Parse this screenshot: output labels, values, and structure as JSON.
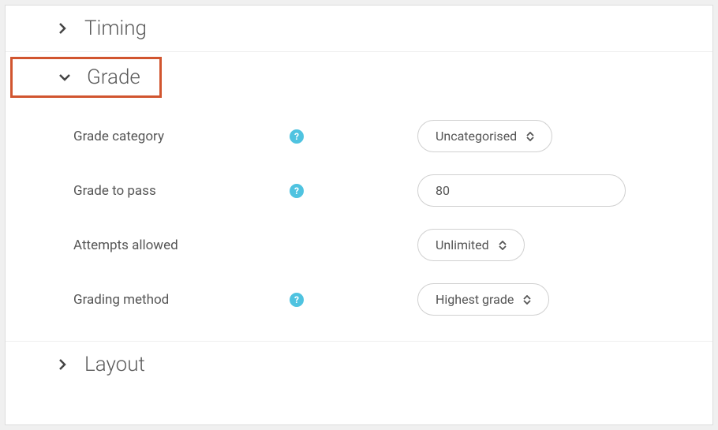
{
  "sections": {
    "timing": {
      "title": "Timing",
      "expanded": false
    },
    "grade": {
      "title": "Grade",
      "expanded": true,
      "fields": {
        "grade_category": {
          "label": "Grade category",
          "help": true,
          "value": "Uncategorised"
        },
        "grade_to_pass": {
          "label": "Grade to pass",
          "help": true,
          "value": "80"
        },
        "attempts_allowed": {
          "label": "Attempts allowed",
          "help": false,
          "value": "Unlimited"
        },
        "grading_method": {
          "label": "Grading method",
          "help": true,
          "value": "Highest grade"
        }
      }
    },
    "layout": {
      "title": "Layout",
      "expanded": false
    }
  }
}
